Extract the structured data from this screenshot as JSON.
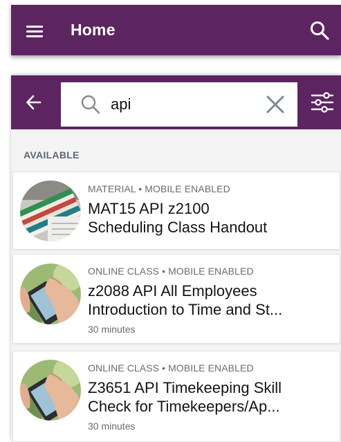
{
  "header": {
    "title": "Home",
    "menu_icon": "hamburger-menu-icon",
    "search_icon": "search-icon",
    "background": "#5d2462"
  },
  "search": {
    "value": "api",
    "back_icon": "arrow-left-icon",
    "search_icon": "search-icon",
    "clear_icon": "close-icon",
    "filter_icon": "filter-sliders-icon"
  },
  "results": {
    "section_label": "AVAILABLE",
    "items": [
      {
        "meta": "MATERIAL • MOBILE ENABLED",
        "title_line1": "MAT15 API z2100",
        "title_line2": "Scheduling Class Handout",
        "duration": ""
      },
      {
        "meta": "ONLINE CLASS • MOBILE ENABLED",
        "title_line1": "z2088 API All Employees",
        "title_line2": "Introduction to Time and St...",
        "duration": "30 minutes"
      },
      {
        "meta": "ONLINE CLASS • MOBILE ENABLED",
        "title_line1": "Z3651 API Timekeeping Skill",
        "title_line2": "Check for Timekeepers/Ap...",
        "duration": "30 minutes"
      }
    ]
  }
}
